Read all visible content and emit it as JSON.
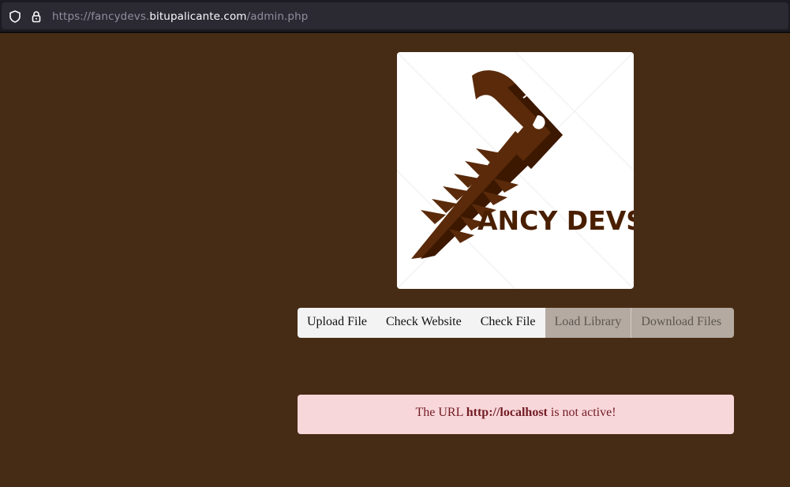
{
  "browser": {
    "url_prefix": "https://fancydevs.",
    "url_host": "bitupalicante.com",
    "url_path": "/admin.php"
  },
  "logo": {
    "text": "ANCY DEVS",
    "color": "#4a1f00"
  },
  "nav": {
    "buttons": [
      {
        "label": "Upload File",
        "state": "active"
      },
      {
        "label": "Check Website",
        "state": "active"
      },
      {
        "label": "Check File",
        "state": "active"
      },
      {
        "label": "Load Library",
        "state": "disabled"
      },
      {
        "label": "Download Files",
        "state": "disabled"
      }
    ]
  },
  "alert": {
    "prefix": "The URL ",
    "url": "http://localhost",
    "suffix": " is not active!"
  },
  "colors": {
    "background": "#472c15",
    "alert_bg": "#f8d7da",
    "alert_text": "#721c24"
  }
}
